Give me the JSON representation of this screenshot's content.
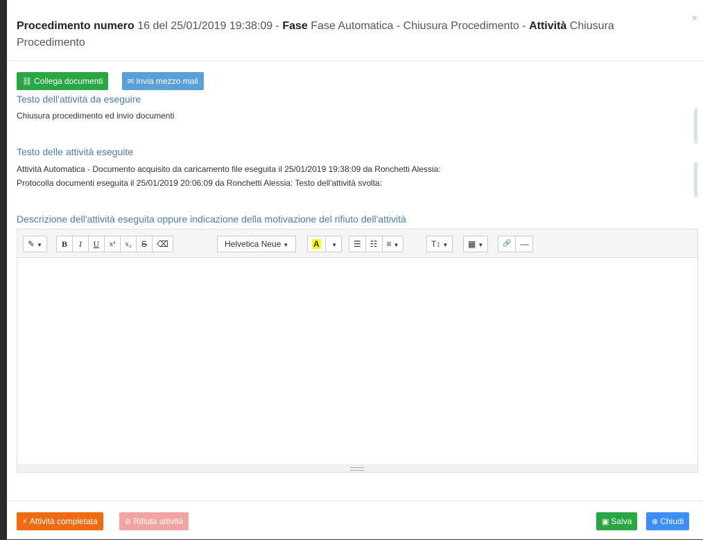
{
  "header": {
    "proc_label": "Procedimento numero",
    "proc_value": "16 del 25/01/2019 19:38:09 -",
    "phase_label": "Fase",
    "phase_value": "Fase Automatica - Chiusura Procedimento -",
    "activity_label": "Attività",
    "activity_value": "Chiusura Procedimento",
    "close_glyph": "×"
  },
  "actions": {
    "link_docs": "Collega documenti",
    "send_mail": "Invia mezzo mail"
  },
  "todo": {
    "label": "Testo dell'attività da eseguire",
    "text": "Chiusura procedimento ed invio documenti"
  },
  "done": {
    "label": "Testo delle attività eseguite",
    "line1": "Attività Automatica - Documento acquisito da caricamento file eseguita il 25/01/2019 19:38:09 da Ronchetti Alessia:",
    "line2": "Protocolla documenti eseguita il 25/01/2019 20:06:09 da Ronchetti Alessia: Testo dell'attività svolta:"
  },
  "description": {
    "label": "Descrizione dell'attività eseguita oppure indicazione della motivazione del rifiuto dell'attività"
  },
  "toolbar": {
    "style": "✎",
    "bold": "B",
    "italic": "I",
    "underline": "U",
    "superscript": "x²",
    "subscript": "x₂",
    "strike": "S",
    "eraser": "⌫",
    "font_name": "Helvetica Neue",
    "color_a": "A",
    "ul": "☰",
    "ol": "☷",
    "align": "≡",
    "height": "T↕",
    "table": "▦",
    "link": "🔗",
    "hr": "—"
  },
  "footer": {
    "complete": "Attività completata",
    "reject": "Rifiuta attività",
    "save": "Salva",
    "close": "Chiudi"
  }
}
